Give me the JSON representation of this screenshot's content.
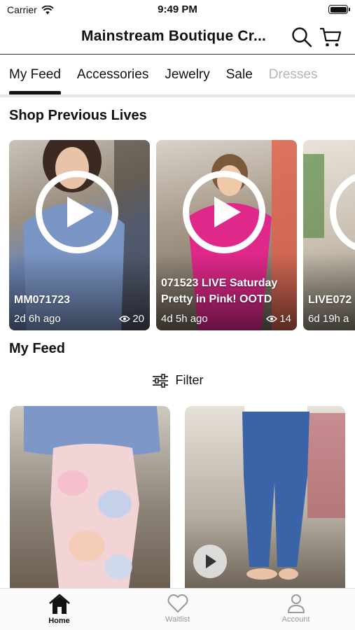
{
  "status_bar": {
    "carrier": "Carrier",
    "time": "9:49 PM"
  },
  "header": {
    "title": "Mainstream Boutique Cr...",
    "search_icon": "search-icon",
    "cart_icon": "cart-icon"
  },
  "tabs": [
    {
      "label": "My Feed",
      "active": true
    },
    {
      "label": "Accessories"
    },
    {
      "label": "Jewelry"
    },
    {
      "label": "Sale"
    },
    {
      "label": "Dresses"
    }
  ],
  "previous_lives": {
    "title": "Shop Previous Lives",
    "items": [
      {
        "title": "MM071723",
        "age": "2d 6h ago",
        "views": "20",
        "color": "#6f87b8"
      },
      {
        "title": "071523 LIVE Saturday Pretty in Pink! OOTD",
        "age": "4d 5h ago",
        "views": "14",
        "color": "#e0288a"
      },
      {
        "title": "LIVE072",
        "age": "6d 19h a",
        "views": "",
        "color": "#d9d2c7"
      }
    ]
  },
  "my_feed": {
    "title": "My Feed",
    "filter_label": "Filter",
    "items": [
      {
        "name": "tie-dye-jogger-post"
      },
      {
        "name": "denim-jeans-post"
      }
    ]
  },
  "bottom_nav": [
    {
      "label": "Home",
      "icon": "home-icon",
      "active": true
    },
    {
      "label": "Waitlist",
      "icon": "heart-icon"
    },
    {
      "label": "Account",
      "icon": "account-icon"
    }
  ]
}
